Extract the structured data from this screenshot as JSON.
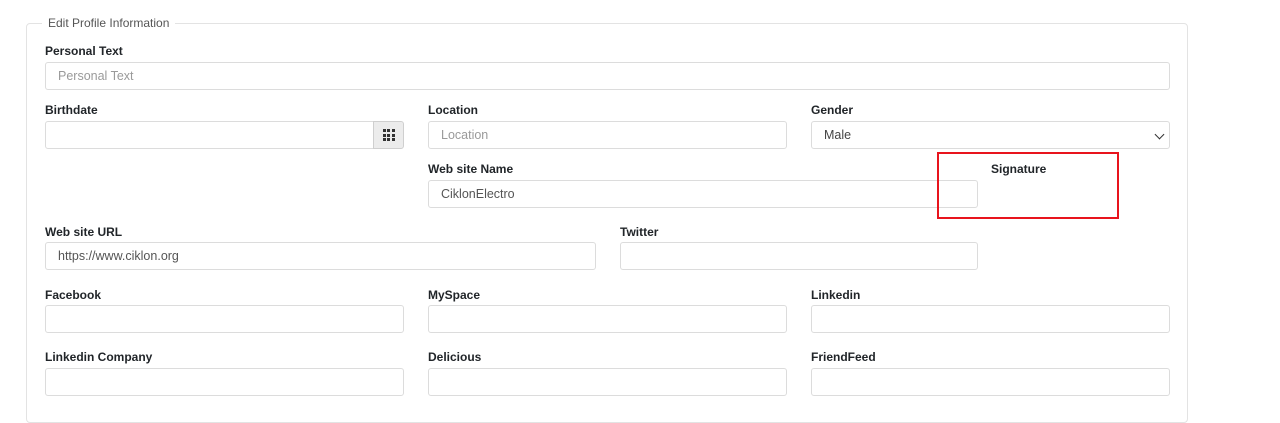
{
  "form": {
    "legend": "Edit Profile Information",
    "personal_text": {
      "label": "Personal Text",
      "value": "",
      "placeholder": "Personal Text"
    },
    "birthdate": {
      "label": "Birthdate",
      "value": ""
    },
    "location": {
      "label": "Location",
      "value": "",
      "placeholder": "Location"
    },
    "gender": {
      "label": "Gender",
      "selected": "Male"
    },
    "website_name": {
      "label": "Web site Name",
      "value": "CiklonElectro"
    },
    "signature": {
      "label": "Signature"
    },
    "website_url": {
      "label": "Web site URL",
      "value": "https://www.ciklon.org"
    },
    "twitter": {
      "label": "Twitter",
      "value": ""
    },
    "facebook": {
      "label": "Facebook",
      "value": ""
    },
    "myspace": {
      "label": "MySpace",
      "value": ""
    },
    "linkedin": {
      "label": "Linkedin",
      "value": ""
    },
    "linkedin_company": {
      "label": "Linkedin Company",
      "value": ""
    },
    "delicious": {
      "label": "Delicious",
      "value": ""
    },
    "friendfeed": {
      "label": "FriendFeed",
      "value": ""
    }
  },
  "icons": {
    "calendar_button": "grid-icon",
    "select_arrow": "chevron-down-icon"
  },
  "colors": {
    "highlight_border": "#e8141d",
    "input_border": "#dcdcdc",
    "addon_bg": "#ececec"
  }
}
